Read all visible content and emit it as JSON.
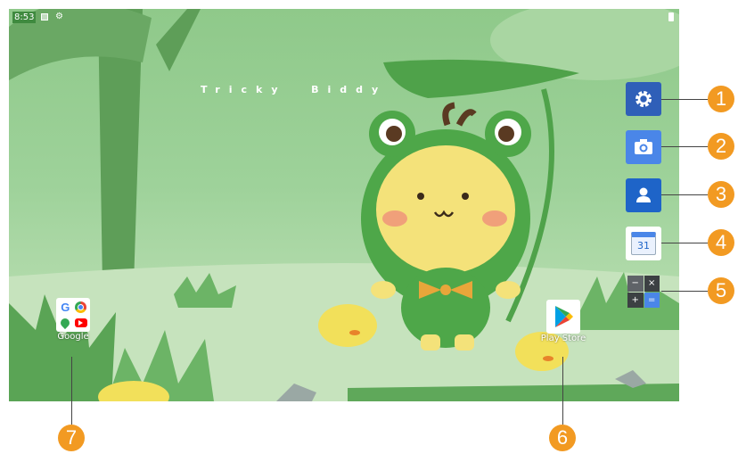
{
  "status_bar": {
    "time": "8:53"
  },
  "wallpaper": {
    "title": "Tricky  Biddy"
  },
  "dock": [
    {
      "name": "settings",
      "number": "1",
      "color": "#2f5fb8"
    },
    {
      "name": "camera",
      "number": "2",
      "color": "#4a86e8"
    },
    {
      "name": "contacts",
      "number": "3",
      "color": "#1e64c8"
    },
    {
      "name": "calendar",
      "number": "4",
      "day": "31",
      "color": "#ffffff"
    },
    {
      "name": "calculator",
      "number": "5",
      "color": "#5f6368"
    }
  ],
  "calculator_symbols": [
    "−",
    "×",
    "+",
    "="
  ],
  "home_icons": {
    "play_store": {
      "label": "Play Store",
      "number": "6"
    },
    "google_folder": {
      "label": "Google",
      "number": "7",
      "apps": [
        "G",
        "Chrome",
        "Maps",
        "YouTube"
      ]
    }
  },
  "colors": {
    "callout": "#f29a22",
    "wallpaper_green": "#8fc98a"
  }
}
